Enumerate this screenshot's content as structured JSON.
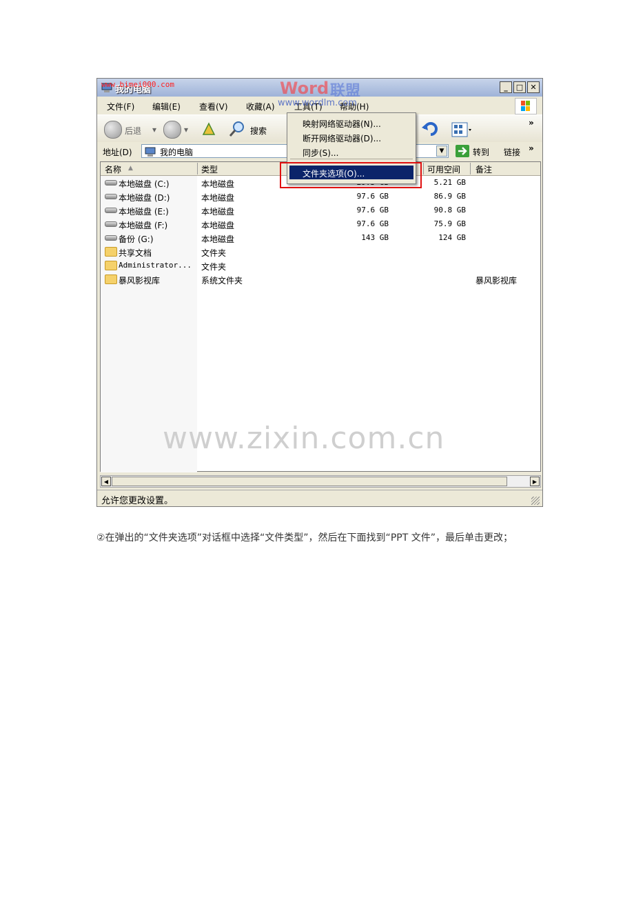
{
  "window": {
    "title": "我的电脑",
    "watermark_small": "www.bimei000.com",
    "watermark_brand_a": "Word",
    "watermark_brand_b": "联盟",
    "watermark_url": "www.wordlm.com"
  },
  "menubar": {
    "items": [
      "文件(F)",
      "编辑(E)",
      "查看(V)",
      "收藏(A)",
      "工具(T)",
      "帮助(H)"
    ]
  },
  "toolbar": {
    "back_label": "后退",
    "search_label": "搜索"
  },
  "address": {
    "label": "地址(D)",
    "value": "我的电脑",
    "go_label": "转到",
    "links_label": "链接"
  },
  "columns": [
    "名称",
    "类型",
    "可用空间",
    "备注"
  ],
  "rows": [
    {
      "name": "本地磁盘 (C:)",
      "type": "本地磁盘",
      "total": "29.3 GB",
      "free": "5.21 GB",
      "note": ""
    },
    {
      "name": "本地磁盘 (D:)",
      "type": "本地磁盘",
      "total": "97.6 GB",
      "free": "86.9 GB",
      "note": ""
    },
    {
      "name": "本地磁盘 (E:)",
      "type": "本地磁盘",
      "total": "97.6 GB",
      "free": "90.8 GB",
      "note": ""
    },
    {
      "name": "本地磁盘 (F:)",
      "type": "本地磁盘",
      "total": "97.6 GB",
      "free": "75.9 GB",
      "note": ""
    },
    {
      "name": "备份 (G:)",
      "type": "本地磁盘",
      "total": "143 GB",
      "free": "124 GB",
      "note": ""
    },
    {
      "name": "共享文档",
      "type": "文件夹",
      "total": "",
      "free": "",
      "note": ""
    },
    {
      "name": "Administrator...",
      "type": "文件夹",
      "total": "",
      "free": "",
      "note": ""
    },
    {
      "name": "暴风影视库",
      "type": "系统文件夹",
      "total": "",
      "free": "",
      "note": "暴风影视库"
    }
  ],
  "tools_menu": {
    "items": [
      "映射网络驱动器(N)...",
      "断开网络驱动器(D)...",
      "同步(S)..."
    ],
    "selected": "文件夹选项(O)..."
  },
  "status": "允许您更改设置。",
  "background_watermark": "www.zixin.com.cn",
  "caption": "②在弹出的“文件夹选项”对话框中选择“文件类型”，然后在下面找到“PPT 文件”，最后单击更改；"
}
